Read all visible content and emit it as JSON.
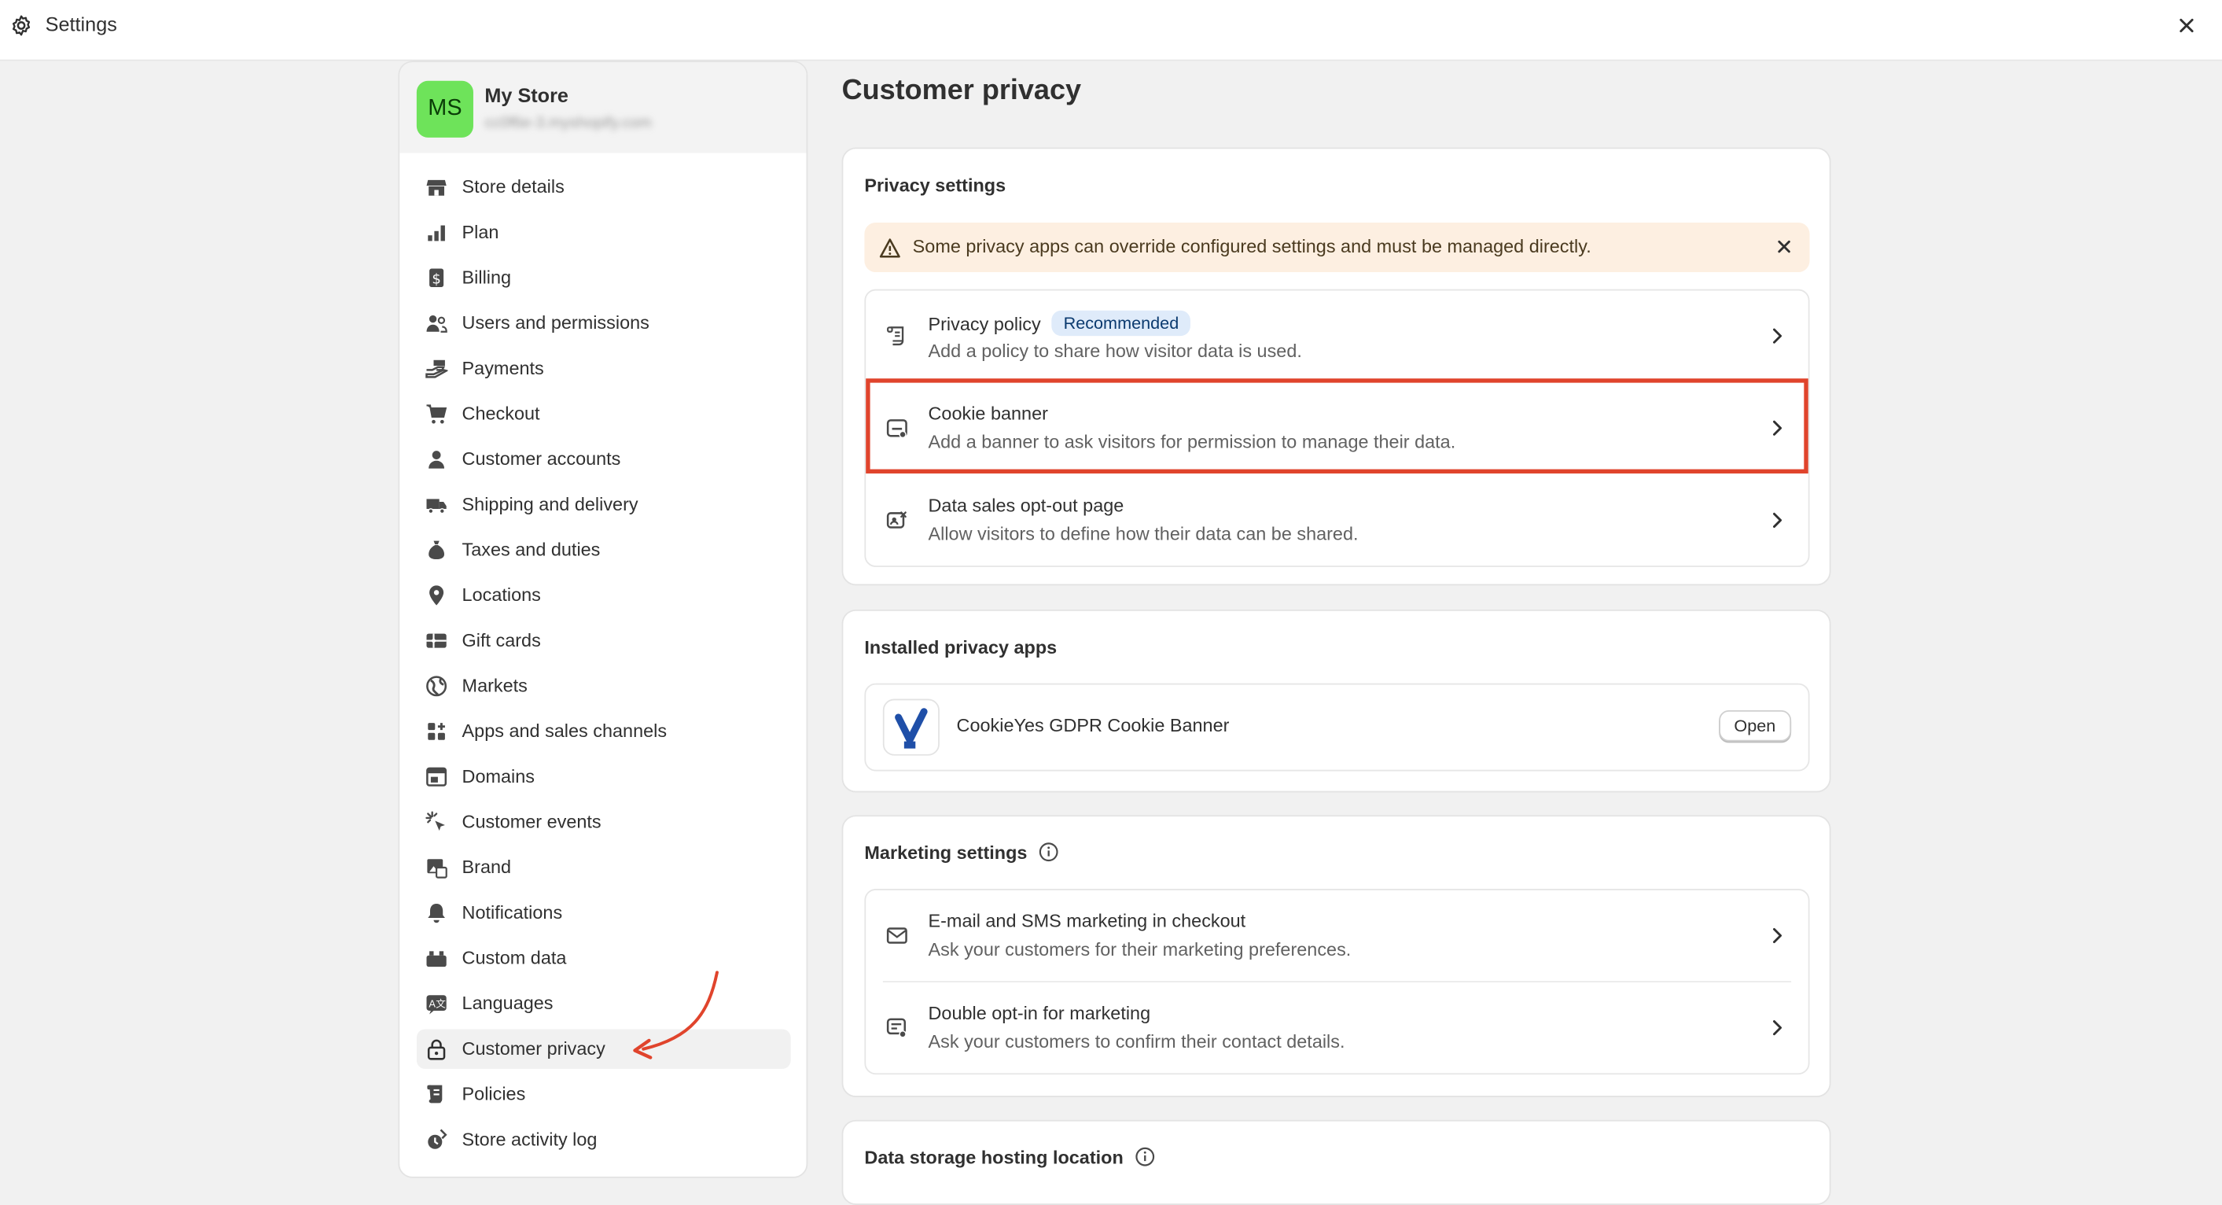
{
  "topbar": {
    "title": "Settings"
  },
  "sidebar": {
    "avatar_initials": "MS",
    "store_name": "My Store",
    "store_email": "cc0f6e-3.myshopify.com",
    "items": [
      {
        "label": "Store details",
        "icon": "store-icon"
      },
      {
        "label": "Plan",
        "icon": "plan-chart-icon"
      },
      {
        "label": "Billing",
        "icon": "billing-dollar-icon"
      },
      {
        "label": "Users and permissions",
        "icon": "users-icon"
      },
      {
        "label": "Payments",
        "icon": "payments-hand-icon"
      },
      {
        "label": "Checkout",
        "icon": "cart-icon"
      },
      {
        "label": "Customer accounts",
        "icon": "person-icon"
      },
      {
        "label": "Shipping and delivery",
        "icon": "truck-icon"
      },
      {
        "label": "Taxes and duties",
        "icon": "money-bag-icon"
      },
      {
        "label": "Locations",
        "icon": "location-pin-icon"
      },
      {
        "label": "Gift cards",
        "icon": "gift-card-icon"
      },
      {
        "label": "Markets",
        "icon": "globe-icon"
      },
      {
        "label": "Apps and sales channels",
        "icon": "apps-grid-icon"
      },
      {
        "label": "Domains",
        "icon": "domains-window-icon"
      },
      {
        "label": "Customer events",
        "icon": "cursor-click-icon"
      },
      {
        "label": "Brand",
        "icon": "brand-image-icon"
      },
      {
        "label": "Notifications",
        "icon": "bell-icon"
      },
      {
        "label": "Custom data",
        "icon": "custom-data-icon"
      },
      {
        "label": "Languages",
        "icon": "language-icon"
      },
      {
        "label": "Customer privacy",
        "icon": "lock-icon",
        "active": true
      },
      {
        "label": "Policies",
        "icon": "policies-scroll-icon"
      },
      {
        "label": "Store activity log",
        "icon": "activity-log-icon"
      }
    ]
  },
  "main": {
    "page_title": "Customer privacy",
    "privacy_settings": {
      "title": "Privacy settings",
      "banner_text": "Some privacy apps can override configured settings and must be managed directly.",
      "rows": [
        {
          "title": "Privacy policy",
          "badge": "Recommended",
          "description": "Add a policy to share how visitor data is used."
        },
        {
          "title": "Cookie banner",
          "description": "Add a banner to ask visitors for permission to manage their data."
        },
        {
          "title": "Data sales opt-out page",
          "description": "Allow visitors to define how their data can be shared."
        }
      ]
    },
    "installed_apps": {
      "title": "Installed privacy apps",
      "app_name": "CookieYes GDPR Cookie Banner",
      "open_label": "Open"
    },
    "marketing_settings": {
      "title": "Marketing settings",
      "rows": [
        {
          "title": "E-mail and SMS marketing in checkout",
          "description": "Ask your customers for their marketing preferences."
        },
        {
          "title": "Double opt-in for marketing",
          "description": "Ask your customers to confirm their contact details."
        }
      ]
    },
    "data_storage": {
      "title": "Data storage hosting location"
    }
  },
  "colors": {
    "highlight": "#e0442c",
    "annotation_arrow": "#e0442c",
    "avatar_bg": "#6ee35a",
    "badge_bg": "#dfebfa",
    "banner_bg": "#fdefe1"
  }
}
